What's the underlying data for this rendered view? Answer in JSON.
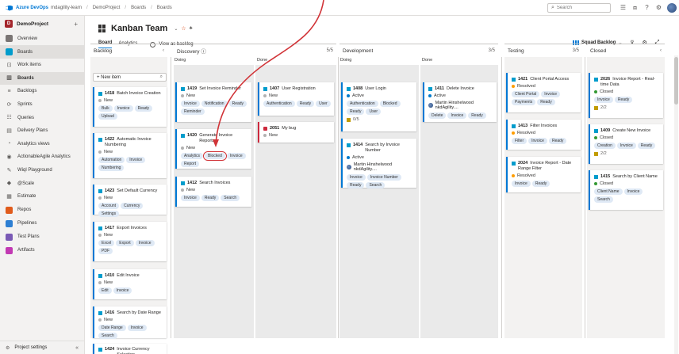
{
  "topbar": {
    "brand": "Azure DevOps",
    "org": "mdagility-learn",
    "crumbs": [
      "DemoProject",
      "Boards",
      "Boards"
    ],
    "search_placeholder": "Search"
  },
  "sidebar": {
    "project_initial": "D",
    "project_name": "DemoProject",
    "add": "+",
    "items": [
      {
        "label": "Overview",
        "icon_color": "#7a7574"
      },
      {
        "label": "Boards",
        "icon_color": "#009ccc"
      },
      {
        "label": "Work items",
        "sub": true
      },
      {
        "label": "Boards",
        "sub": true,
        "selected": true
      },
      {
        "label": "Backlogs",
        "sub": true
      },
      {
        "label": "Sprints",
        "sub": true
      },
      {
        "label": "Queries",
        "sub": true
      },
      {
        "label": "Delivery Plans",
        "sub": true
      },
      {
        "label": "Analytics views",
        "sub": true
      },
      {
        "label": "ActionableAgile Analytics",
        "sub": true
      },
      {
        "label": "Wiql Playground",
        "sub": true
      },
      {
        "label": "@Scale",
        "sub": true
      },
      {
        "label": "Estimate",
        "sub": true
      },
      {
        "label": "Repos",
        "icon_color": "#e05b1b"
      },
      {
        "label": "Pipelines",
        "icon_color": "#2d7fd3"
      },
      {
        "label": "Test Plans",
        "icon_color": "#7a5ab5"
      },
      {
        "label": "Artifacts",
        "icon_color": "#c239b3"
      }
    ],
    "settings": "Project settings",
    "collapse": "«"
  },
  "header": {
    "team": "Kanban Team",
    "tabs": [
      "Board",
      "Analytics"
    ],
    "view_backlog": "View as backlog",
    "squad": "Squad Backlog"
  },
  "columns": {
    "backlog": {
      "title": "Backlog",
      "chev": "‹",
      "new_item": "+ New item"
    },
    "discovery": {
      "title": "Discovery ⓘ",
      "count": "5/5",
      "doing": "Doing",
      "done": "Done"
    },
    "development": {
      "title": "Development",
      "count": "3/5",
      "doing": "Doing",
      "done": "Done"
    },
    "testing": {
      "title": "Testing",
      "count": "3/5"
    },
    "closed": {
      "title": "Closed",
      "chev": "‹"
    }
  },
  "cards": {
    "c1418": {
      "id": "1418",
      "title": "Batch Invoice Creation",
      "state": "New",
      "tags": [
        "Bulk",
        "Invoice",
        "Ready",
        "Upload"
      ]
    },
    "c1422": {
      "id": "1422",
      "title": "Automatic Invoice Numbering",
      "state": "New",
      "tags": [
        "Automation",
        "Invoice",
        "Numbering"
      ]
    },
    "c1423": {
      "id": "1423",
      "title": "Set Default Currency",
      "state": "New",
      "tags": [
        "Account",
        "Currency",
        "Settings"
      ]
    },
    "c1417": {
      "id": "1417",
      "title": "Export Invoices",
      "state": "New",
      "tags": [
        "Excel",
        "Export",
        "Invoice",
        "PDF"
      ]
    },
    "c1410": {
      "id": "1410",
      "title": "Edit Invoice",
      "state": "New",
      "tags": [
        "Edit",
        "Invoice"
      ]
    },
    "c1416": {
      "id": "1416",
      "title": "Search by Date Range",
      "state": "New",
      "tags": [
        "Date Range",
        "Invoice",
        "Search"
      ]
    },
    "c1424": {
      "id": "1424",
      "title": "Invoice Currency Selection"
    },
    "c1419": {
      "id": "1419",
      "title": "Set Invoice Reminder",
      "state": "New",
      "tags": [
        "Invoice",
        "Notification",
        "Ready",
        "Reminder"
      ]
    },
    "c1420": {
      "id": "1420",
      "title": "Generate Invoice Reports",
      "state": "New",
      "tags": [
        "Analytics",
        "Blocked",
        "Invoice",
        "Report"
      ]
    },
    "c1412": {
      "id": "1412",
      "title": "Search Invoices",
      "state": "New",
      "tags": [
        "Invoice",
        "Ready",
        "Search"
      ]
    },
    "c1407": {
      "id": "1407",
      "title": "User Registration",
      "state": "New",
      "tags": [
        "Authentication",
        "Ready",
        "User"
      ]
    },
    "c2051": {
      "id": "2051",
      "title": "My bug",
      "state": "New"
    },
    "c1408": {
      "id": "1408",
      "title": "User Login",
      "state": "Active",
      "tags": [
        "Authentication",
        "Blocked",
        "Ready",
        "User"
      ],
      "meta": "0/5"
    },
    "c1414": {
      "id": "1414",
      "title": "Search by Invoice Number",
      "state": "Active",
      "assignee": "Martin Hinshelwood nkdAgility....",
      "tags": [
        "Invoice",
        "Invoice Number",
        "Ready",
        "Search"
      ]
    },
    "c1411": {
      "id": "1411",
      "title": "Delete Invoice",
      "state": "Active",
      "assignee": "Martin Hinshelwood nkdAgility....",
      "tags": [
        "Delete",
        "Invoice",
        "Ready"
      ]
    },
    "c1421": {
      "id": "1421",
      "title": "Client Portal Access",
      "state": "Resolved",
      "tags": [
        "Client Portal",
        "Invoice",
        "Payments",
        "Ready"
      ]
    },
    "c1413": {
      "id": "1413",
      "title": "Filter Invoices",
      "state": "Resolved",
      "tags": [
        "Filter",
        "Invoice",
        "Ready"
      ]
    },
    "c2024": {
      "id": "2024",
      "title": "Invoice Report - Date Range Filter",
      "state": "Resolved",
      "tags": [
        "Invoice",
        "Ready"
      ]
    },
    "c2026": {
      "id": "2026",
      "title": "Invoice Report - Real-time Data",
      "state": "Closed",
      "tags": [
        "Invoice",
        "Ready"
      ],
      "meta": "2/2"
    },
    "c1409": {
      "id": "1409",
      "title": "Create New Invoice",
      "state": "Closed",
      "tags": [
        "Creation",
        "Invoice",
        "Ready"
      ],
      "meta": "2/2"
    },
    "c1415": {
      "id": "1415",
      "title": "Search by Client Name",
      "state": "Closed",
      "tags": [
        "Client Name",
        "Invoice",
        "Search"
      ]
    }
  }
}
